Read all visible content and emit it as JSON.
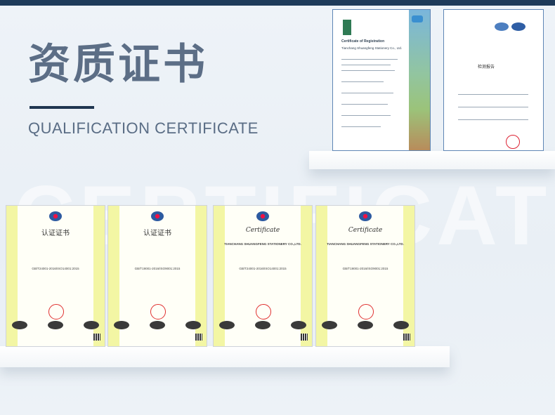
{
  "header": {
    "title_cn": "资质证书",
    "title_en": "QUALIFICATION CERTIFICATE",
    "watermark": "CERTIFICATE"
  },
  "top_documents": [
    {
      "title": "Certificate of Registration",
      "company": "Tianchang Shuangfeng Stationery Co., Ltd."
    },
    {
      "title": "检测报告"
    }
  ],
  "certificates": [
    {
      "heading": "认证证书",
      "standard": "GB/T24001-2016/ISO14001:2015"
    },
    {
      "heading": "认证证书",
      "standard": "GB/T19001-2016/ISO9001:2015"
    },
    {
      "heading": "Certificate",
      "company": "TIANCHANG SHUANGFENG STATIONERY CO.,LTD.",
      "standard": "GB/T24001-2016/ISO14001:2015"
    },
    {
      "heading": "Certificate",
      "company": "TIANCHANG SHUANGFENG STATIONERY CO.,LTD.",
      "standard": "GB/T19001-2016/ISO9001:2015"
    }
  ]
}
